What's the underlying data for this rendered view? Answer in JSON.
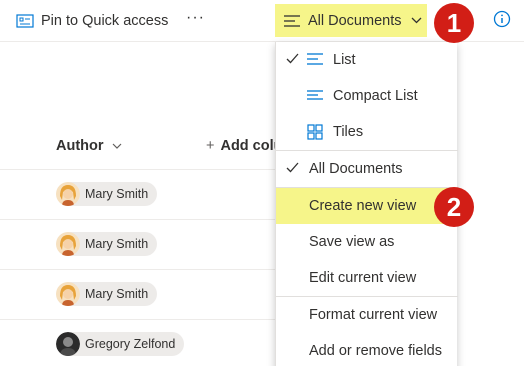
{
  "commandbar": {
    "pin_label": "Pin to Quick access",
    "more_label": "···",
    "view_label": "All Documents"
  },
  "badges": {
    "one": "1",
    "two": "2"
  },
  "list": {
    "author_header": "Author",
    "add_column_plus": "+",
    "add_column_label": "Add colu",
    "rows": [
      {
        "name": "Mary Smith"
      },
      {
        "name": "Mary Smith"
      },
      {
        "name": "Mary Smith"
      },
      {
        "name": "Gregory Zelfond"
      }
    ]
  },
  "menu": {
    "items": [
      {
        "label": "List",
        "checked": true,
        "icon": "list-icon"
      },
      {
        "label": "Compact List",
        "checked": false,
        "icon": "compact-list-icon"
      },
      {
        "label": "Tiles",
        "checked": false,
        "icon": "tiles-icon"
      },
      {
        "label": "All Documents",
        "checked": true
      },
      {
        "label": "Create new view",
        "highlighted": true
      },
      {
        "label": "Save view as"
      },
      {
        "label": "Edit current view"
      },
      {
        "label": "Format current view"
      },
      {
        "label": "Add or remove fields"
      }
    ]
  },
  "colors": {
    "accent": "#0078d4",
    "highlight": "#f6f58a",
    "badge": "#d21e16"
  }
}
